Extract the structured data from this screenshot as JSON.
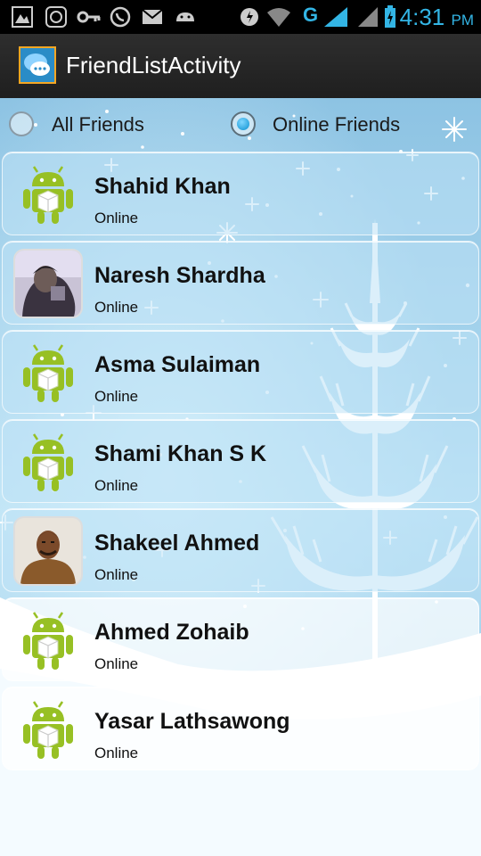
{
  "status_bar": {
    "time": "4:31",
    "ampm": "PM",
    "network": "G",
    "icons": [
      "gallery-icon",
      "sync-icon",
      "key-icon",
      "whatsapp-icon",
      "gmail-icon",
      "android-icon",
      "alert-icon",
      "wifi-icon",
      "signal-icon",
      "battery-charging-icon"
    ]
  },
  "action_bar": {
    "title": "FriendListActivity",
    "icon": "chat-bubbles-icon"
  },
  "filter": {
    "options": [
      {
        "label": "All Friends",
        "checked": false
      },
      {
        "label": "Online Friends",
        "checked": true
      }
    ]
  },
  "friends": [
    {
      "name": "Shahid Khan",
      "status": "Online",
      "avatar": "android-default"
    },
    {
      "name": "Naresh Shardha",
      "status": "Online",
      "avatar": "photo"
    },
    {
      "name": "Asma Sulaiman",
      "status": "Online",
      "avatar": "android-default"
    },
    {
      "name": "Shami Khan S K",
      "status": "Online",
      "avatar": "android-default"
    },
    {
      "name": "Shakeel Ahmed",
      "status": "Online",
      "avatar": "photo"
    },
    {
      "name": "Ahmed Zohaib",
      "status": "Online",
      "avatar": "android-default"
    },
    {
      "name": "Yasar Lathsawong",
      "status": "Online",
      "avatar": "android-default"
    }
  ],
  "colors": {
    "accent": "#33b5e5",
    "android_green": "#97c024",
    "radio_selected": "#0a8fd0"
  }
}
